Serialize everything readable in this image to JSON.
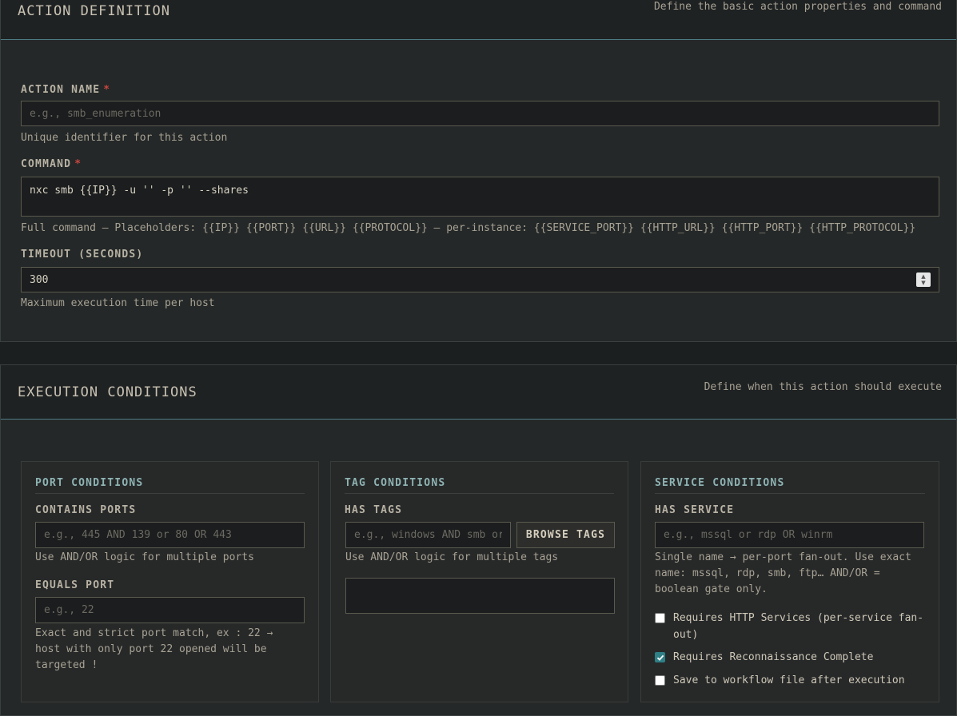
{
  "action_definition": {
    "title": "ACTION DEFINITION",
    "description": "Define the basic action properties and command",
    "action_name": {
      "label": "ACTION NAME",
      "required": "*",
      "placeholder": "e.g., smb_enumeration",
      "value": "",
      "hint": "Unique identifier for this action"
    },
    "command": {
      "label": "COMMAND",
      "required": "*",
      "value": "nxc smb {{IP}} -u '' -p '' --shares",
      "hint": "Full command — Placeholders: {{IP}} {{PORT}} {{URL}} {{PROTOCOL}} — per-instance: {{SERVICE_PORT}} {{HTTP_URL}} {{HTTP_PORT}} {{HTTP_PROTOCOL}}"
    },
    "timeout": {
      "label": "TIMEOUT (SECONDS)",
      "value": "300",
      "hint": "Maximum execution time per host"
    }
  },
  "execution_conditions": {
    "title": "EXECUTION CONDITIONS",
    "description": "Define when this action should execute",
    "port_conditions": {
      "title": "PORT CONDITIONS",
      "contains_ports": {
        "label": "CONTAINS PORTS",
        "placeholder": "e.g., 445 AND 139 or 80 OR 443",
        "hint": "Use AND/OR logic for multiple ports"
      },
      "equals_port": {
        "label": "EQUALS PORT",
        "placeholder": "e.g., 22",
        "hint": "Exact and strict port match, ex : 22 → host with only port 22 opened will be targeted !"
      }
    },
    "tag_conditions": {
      "title": "TAG CONDITIONS",
      "has_tags": {
        "label": "HAS TAGS",
        "placeholder": "e.g., windows AND smb or",
        "button": "BROWSE TAGS",
        "hint": "Use AND/OR logic for multiple tags"
      }
    },
    "service_conditions": {
      "title": "SERVICE CONDITIONS",
      "has_service": {
        "label": "HAS SERVICE",
        "placeholder": "e.g., mssql or rdp OR winrm",
        "hint": "Single name → per-port fan-out. Use exact name: mssql, rdp, smb, ftp… AND/OR = boolean gate only."
      },
      "checkboxes": [
        {
          "label": "Requires HTTP Services (per-service fan-out)",
          "checked": false
        },
        {
          "label": "Requires Reconnaissance Complete",
          "checked": true
        },
        {
          "label": "Save to workflow file after execution",
          "checked": false
        }
      ]
    }
  },
  "colors": {
    "accent": "#2f7f86",
    "required": "#c8463f",
    "card_title": "#8fb3b3"
  }
}
